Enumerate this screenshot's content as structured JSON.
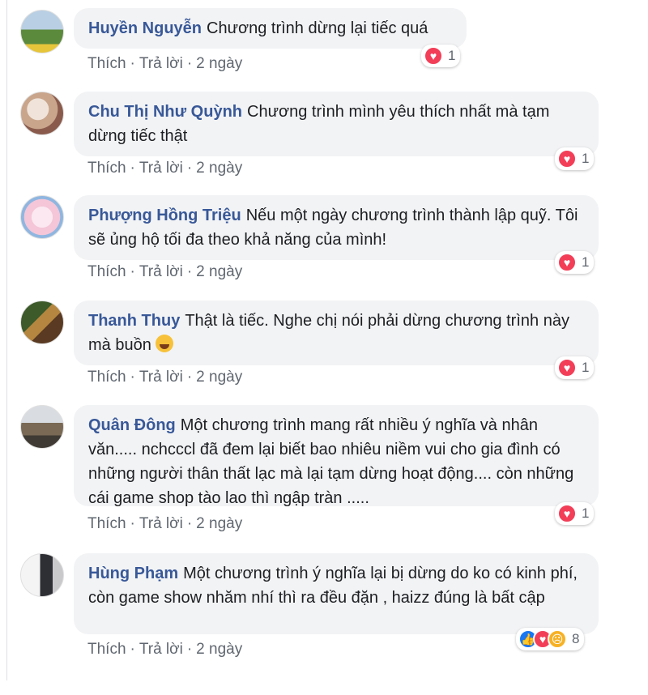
{
  "actions": {
    "like": "Thích",
    "reply": "Trả lời",
    "sep": "·"
  },
  "comments": [
    {
      "author": "Huyền Nguyễn",
      "text": "Chương trình dừng lại tiếc quá",
      "time": "2 ngày",
      "reaction_count": "1",
      "reactions": [
        "heart"
      ]
    },
    {
      "author": "Chu Thị Như Quỳnh",
      "text": "Chương trình mình yêu thích nhất mà tạm dừng tiếc thật",
      "time": "2 ngày",
      "reaction_count": "1",
      "reactions": [
        "heart"
      ]
    },
    {
      "author": "Phượng Hồng Triệu",
      "text": "Nếu một ngày chương trình thành lập quỹ. Tôi sẽ ủng hộ tối đa theo khả năng của mình!",
      "time": "2 ngày",
      "reaction_count": "1",
      "reactions": [
        "heart"
      ]
    },
    {
      "author": "Thanh Thuy",
      "text": "Thật là tiếc. Nghe chị nói phải dừng chương trình này mà buồn",
      "time": "2 ngày",
      "reaction_count": "1",
      "reactions": [
        "heart"
      ],
      "emoji": "crying-laughing-emoji"
    },
    {
      "author": "Quân Đông",
      "text": "Một chương trình mang rất nhiều ý nghĩa và nhân văn..... nchcccl đã đem lại biết bao nhiêu niềm vui cho gia đình có những người thân thất lạc mà lại tạm dừng hoạt động.... còn những cái game shop tào lao thì ngập tràn .....",
      "time": "2 ngày",
      "reaction_count": "1",
      "reactions": [
        "heart"
      ]
    },
    {
      "author": "Hùng Phạm",
      "text": "Một chương trình ý nghĩa lại bị dừng do ko có kinh phí, còn game show nhăm nhí thì ra đều đặn , haizz đúng là bất cập",
      "time": "2 ngày",
      "reaction_count": "8",
      "reactions": [
        "like",
        "heart",
        "sad"
      ]
    }
  ],
  "colors": {
    "author": "#385898",
    "bubble": "#f2f3f5",
    "heart": "#f33e58",
    "like": "#1877f2",
    "sad": "#f7b125"
  }
}
